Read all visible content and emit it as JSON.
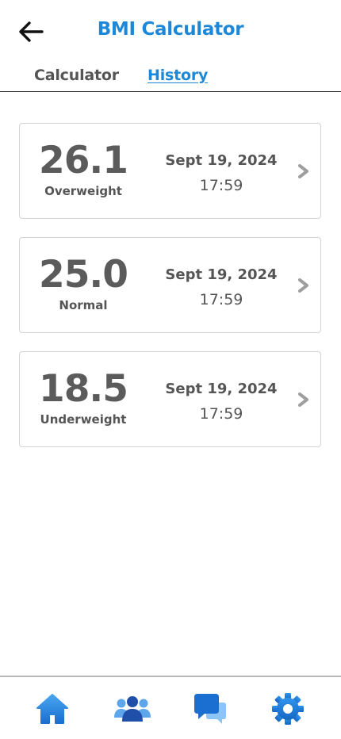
{
  "header": {
    "title": "BMI Calculator",
    "back_icon": "arrow-left-icon"
  },
  "tabs": [
    {
      "label": "Calculator",
      "active": false
    },
    {
      "label": "History",
      "active": true
    }
  ],
  "history": [
    {
      "bmi": "26.1",
      "category": "Overweight",
      "date": "Sept 19, 2024",
      "time": "17:59"
    },
    {
      "bmi": "25.0",
      "category": "Normal",
      "date": "Sept 19, 2024",
      "time": "17:59"
    },
    {
      "bmi": "18.5",
      "category": "Underweight",
      "date": "Sept 19, 2024",
      "time": "17:59"
    }
  ],
  "bottom_nav": [
    {
      "icon": "home-icon"
    },
    {
      "icon": "people-icon"
    },
    {
      "icon": "chat-icon"
    },
    {
      "icon": "gear-icon"
    }
  ],
  "colors": {
    "accent": "#1e88d8",
    "text": "#555555",
    "border": "#d4d4d4",
    "chevron": "#9e9e9e"
  }
}
